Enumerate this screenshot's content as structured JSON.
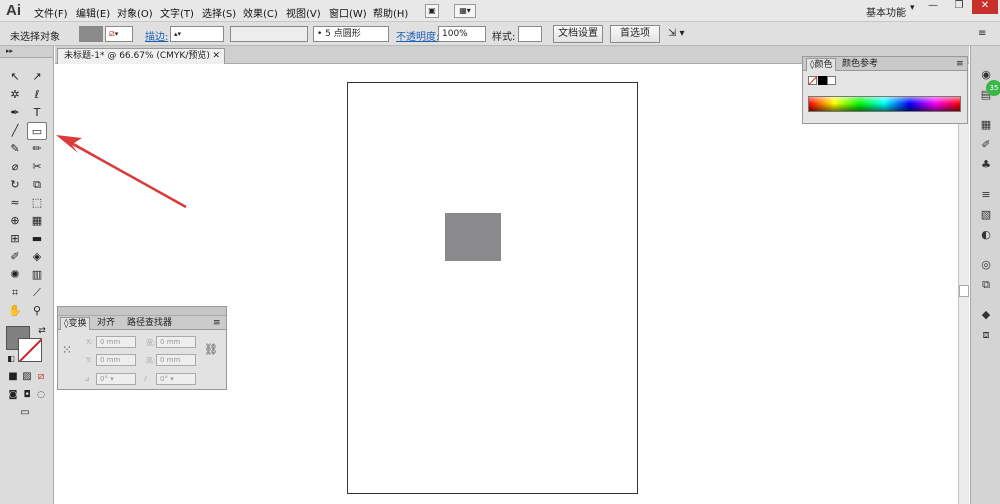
{
  "app": {
    "logo": "Ai"
  },
  "menu": [
    "文件(F)",
    "编辑(E)",
    "对象(O)",
    "文字(T)",
    "选择(S)",
    "效果(C)",
    "视图(V)",
    "窗口(W)",
    "帮助(H)"
  ],
  "workspace": {
    "label": "基本功能"
  },
  "control_bar": {
    "selection_label": "未选择对象",
    "stroke_label": "描边:",
    "brush_label": "5 点圆形",
    "opacity_label": "不透明度:",
    "opacity_value": "100%",
    "style_label": "样式:",
    "doc_setup_label": "文档设置",
    "prefs_label": "首选项"
  },
  "document": {
    "tab_title": "未标题-1* @ 66.67% (CMYK/预览)"
  },
  "color_panel": {
    "tabs": [
      "颜色",
      "颜色参考"
    ]
  },
  "transform_panel": {
    "tabs": [
      "变换",
      "对齐",
      "路径查找器"
    ],
    "x_label": "X:",
    "y_label": "Y:",
    "w_label": "宽:",
    "h_label": "高:",
    "x_value": "0 mm",
    "y_value": "0 mm",
    "w_value": "0 mm",
    "h_value": "0 mm",
    "rotate_value": "0°",
    "shear_value": "0°"
  },
  "badge": {
    "value": "35"
  },
  "colors": {
    "fill": "#808080",
    "accent_red": "#d93a3a",
    "rect": "#8a898b"
  }
}
